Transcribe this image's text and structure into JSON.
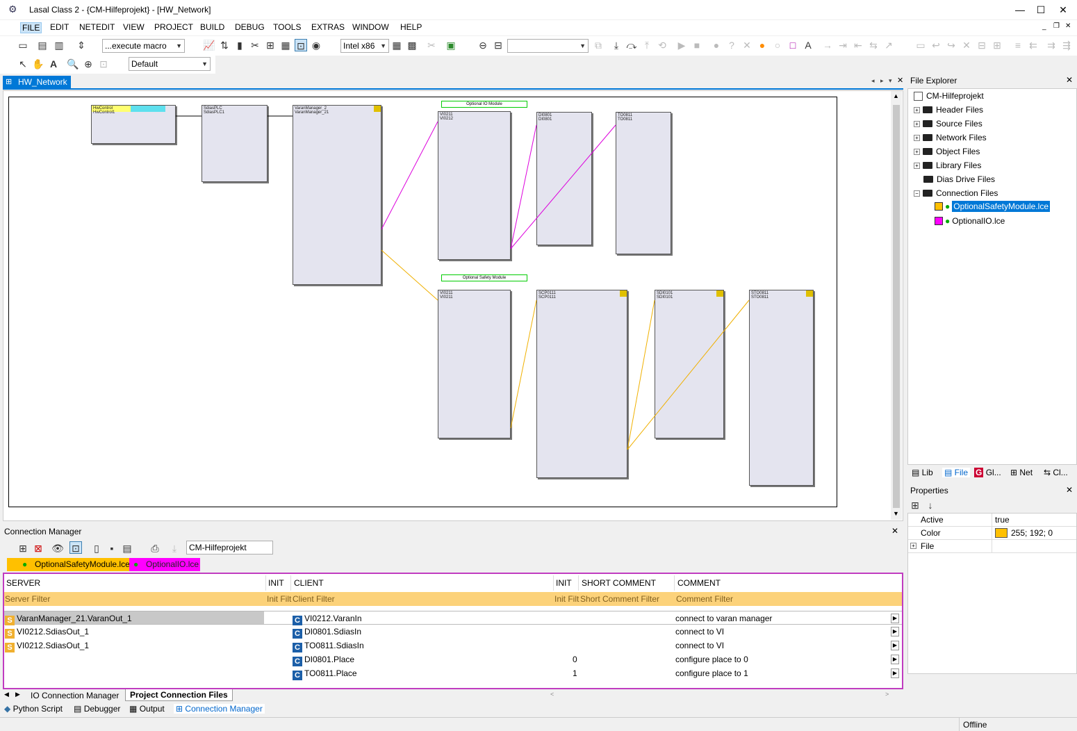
{
  "titlebar": {
    "title": "Lasal Class 2 - {CM-Hilfeprojekt} - [HW_Network]"
  },
  "menu": [
    "FILE",
    "EDIT",
    "NETEDIT",
    "VIEW",
    "PROJECT",
    "BUILD",
    "DEBUG",
    "TOOLS",
    "EXTRAS",
    "WINDOW",
    "HELP"
  ],
  "toolbar": {
    "macro": "...execute macro",
    "platform": "Intel x86",
    "view": "Default"
  },
  "doc_tab": "HW_Network",
  "network": {
    "blocks": [
      {
        "name": "HwControl",
        "sub": "HwControl1"
      },
      {
        "name": "SdiasPLC",
        "sub": "SdiasPLC1"
      },
      {
        "name": "VaranManager_2",
        "sub": "VaranManager_21"
      },
      {
        "name": "VI0211",
        "sub": "VI0212"
      },
      {
        "name": "DI0801",
        "sub": "DI0801"
      },
      {
        "name": "TO0811",
        "sub": "TO0811"
      },
      {
        "name": "VI0211",
        "sub": "VI0211"
      },
      {
        "name": "SCP0111",
        "sub": "SCP0111"
      },
      {
        "name": "SDI0101",
        "sub": "SDI0101"
      },
      {
        "name": "STO0811",
        "sub": "STO0811"
      }
    ],
    "labels": {
      "optional_io": "Optional IO Module",
      "optional_safety": "Optional Safety Module"
    }
  },
  "file_explorer": {
    "title": "File Explorer",
    "root": "CM-Hilfeprojekt",
    "items": [
      "Header Files",
      "Source Files",
      "Network Files",
      "Object Files",
      "Library Files",
      "Dias Drive Files",
      "Connection Files"
    ],
    "connection_files": [
      "OptionalSafetyModule.lce",
      "OptionalIO.lce"
    ],
    "tabs": [
      "Lib",
      "File",
      "Gl...",
      "Net",
      "Cl..."
    ]
  },
  "properties": {
    "title": "Properties",
    "rows": [
      {
        "key": "Active",
        "value": "true"
      },
      {
        "key": "Color",
        "value": "255; 192; 0"
      },
      {
        "key": "File",
        "value": ""
      }
    ]
  },
  "connection_manager": {
    "title": "Connection Manager",
    "project": "CM-Hilfeprojekt",
    "file_tabs": [
      "OptionalSafetyModule.lce",
      "OptionalIO.lce"
    ],
    "columns": [
      "SERVER",
      "INIT",
      "CLIENT",
      "INIT",
      "SHORT COMMENT",
      "COMMENT"
    ],
    "filters": [
      "Server Filter",
      "Init Filt",
      "Client Filter",
      "Init Filt",
      "Short Comment Filter",
      "Comment Filter"
    ],
    "rows": [
      {
        "server": "VaranManager_21.VaranOut_1",
        "client": "VI0212.VaranIn",
        "init": "",
        "comment": "connect to varan manager"
      },
      {
        "server": "VI0212.SdiasOut_1",
        "client": "DI0801.SdiasIn",
        "init": "",
        "comment": "connect to VI"
      },
      {
        "server": "VI0212.SdiasOut_1",
        "client": "TO0811.SdiasIn",
        "init": "",
        "comment": "connect to VI"
      },
      {
        "server": "",
        "client": "DI0801.Place",
        "init": "0",
        "comment": "configure place to 0"
      },
      {
        "server": "",
        "client": "TO0811.Place",
        "init": "1",
        "comment": "configure place to 1"
      }
    ],
    "bottom_tabs": [
      "IO Connection Manager",
      "Project Connection Files"
    ]
  },
  "dock_tabs": [
    "Python Script",
    "Debugger",
    "Output",
    "Connection Manager"
  ],
  "status": {
    "state": "Offline"
  },
  "colors": {
    "accent": "#0078d7",
    "safety": "#ffc000",
    "io": "#ff00ff"
  }
}
